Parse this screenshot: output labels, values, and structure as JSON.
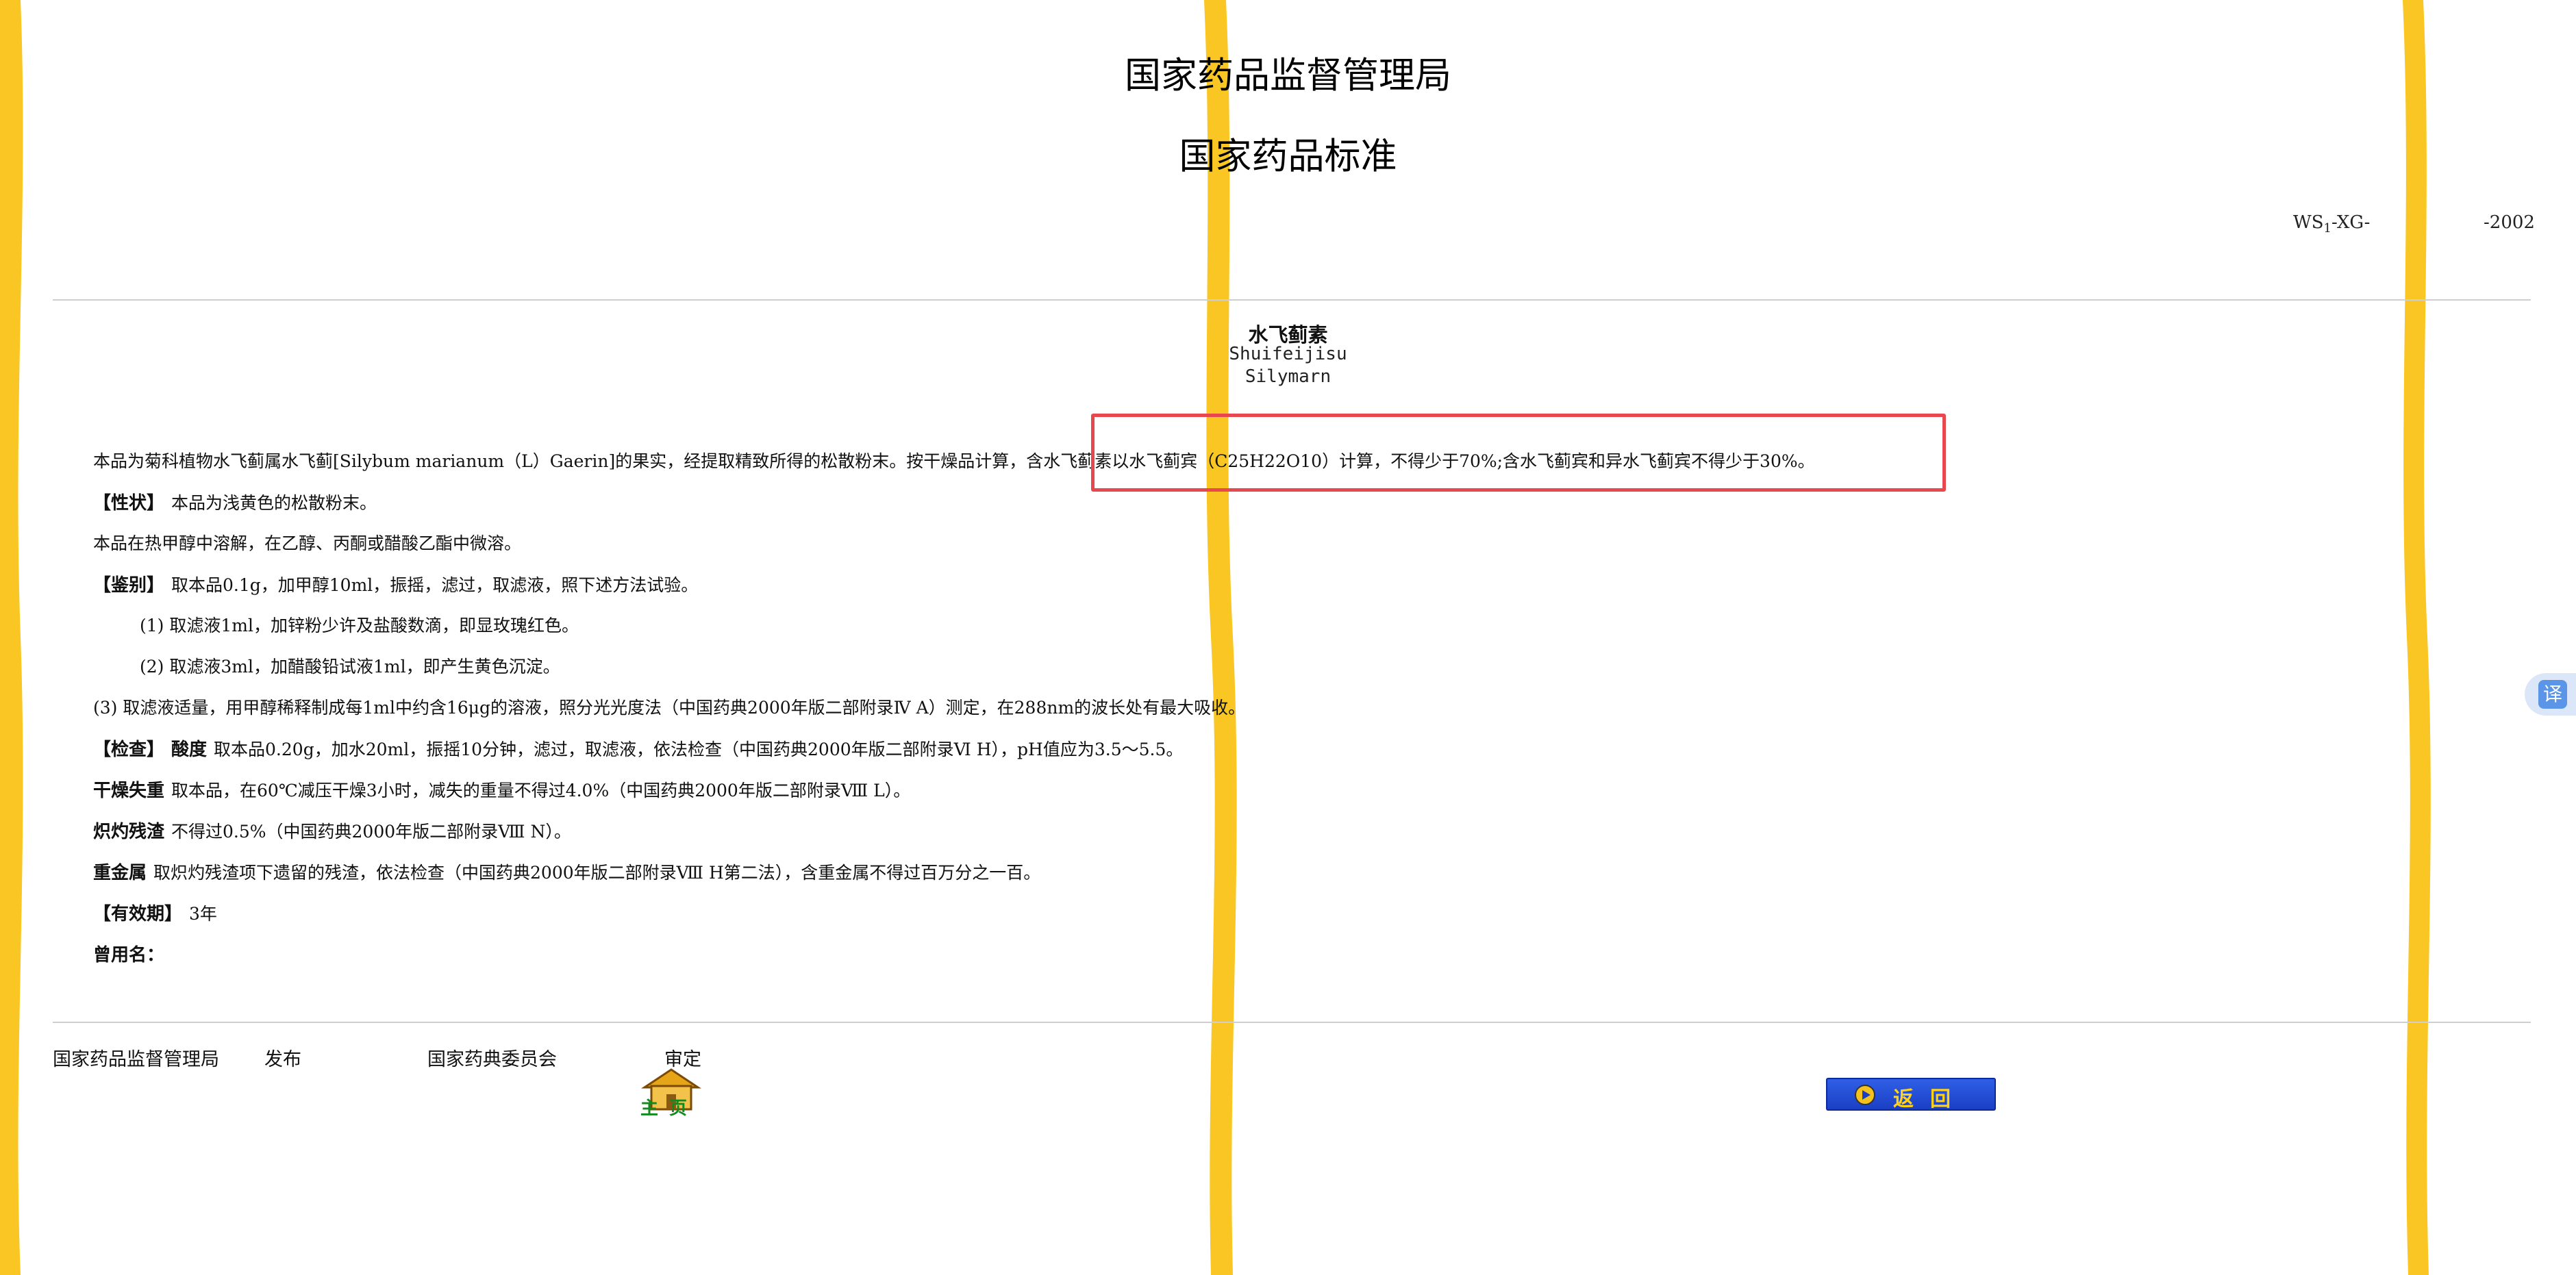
{
  "header": {
    "agency": "国家药品监督管理局",
    "title": "国家药品标准",
    "std_prefix": "WS",
    "std_sub": "1",
    "std_mid": "-XG-",
    "std_year": "-2002"
  },
  "drug": {
    "name_cn": "水飞蓟素",
    "pinyin": "Shuifeijisu",
    "name_en": "Silymarn"
  },
  "body": {
    "intro_a": "本品为菊科植物水飞蓟属水飞蓟[Silybum marianum（L）Gaerin]的果实，经提取精致所得的松散粉末。按干燥品计算，",
    "intro_b": "含水飞蓟素以水飞蓟宾（C25H22O10）计算，不得少于70%;含水飞蓟宾和异水飞蓟宾不得少于30%。",
    "char_label": "【性状】",
    "char_text": "本品为浅黄色的松散粉末。",
    "solubility": "本品在热甲醇中溶解，在乙醇、丙酮或醋酸乙酯中微溶。",
    "ident_label": "【鉴别】",
    "ident_text": "取本品0.1g，加甲醇10ml，振摇，滤过，取滤液，照下述方法试验。",
    "ident_1": "(1) 取滤液1ml，加锌粉少许及盐酸数滴，即显玫瑰红色。",
    "ident_2": "(2) 取滤液3ml，加醋酸铅试液1ml，即产生黄色沉淀。",
    "ident_3": "(3) 取滤液适量，用甲醇稀释制成每1ml中约含16μg的溶液，照分光光度法（中国药典2000年版二部附录Ⅳ A）测定，在288nm的波长处有最大吸收。",
    "check_label": "【检查】",
    "acid_label": "酸度",
    "acid_text": "取本品0.20g，加水20ml，振摇10分钟，滤过，取滤液，依法检查（中国药典2000年版二部附录Ⅵ H），pH值应为3.5～5.5。",
    "dry_label": "干燥失重",
    "dry_text": "取本品，在60℃减压干燥3小时，减失的重量不得过4.0%（中国药典2000年版二部附录Ⅷ L）。",
    "ash_label": "炽灼残渣",
    "ash_text": "不得过0.5%（中国药典2000年版二部附录Ⅷ N）。",
    "metal_label": "重金属",
    "metal_text": "取炽灼残渣项下遗留的残渣，依法检查（中国药典2000年版二部附录Ⅷ H第二法），含重金属不得过百万分之一百。",
    "valid_label": "【有效期】",
    "valid_text": "3年",
    "alias_label": "曾用名："
  },
  "footer": {
    "publisher": "国家药品监督管理局",
    "publish": "发布",
    "reviewer": "国家药典委员会",
    "review": "审定",
    "home_label": "主页",
    "back_label": "返回"
  },
  "widgets": {
    "translate_label": "译"
  },
  "colors": {
    "highlight_border": "#e8474e",
    "stripe": "#f9c623",
    "back_button": "#1a3fc4",
    "back_text": "#ffd21a",
    "translate": "#5b95e8"
  },
  "icons": [
    "home-icon",
    "play-arrow-icon",
    "translate-icon"
  ]
}
